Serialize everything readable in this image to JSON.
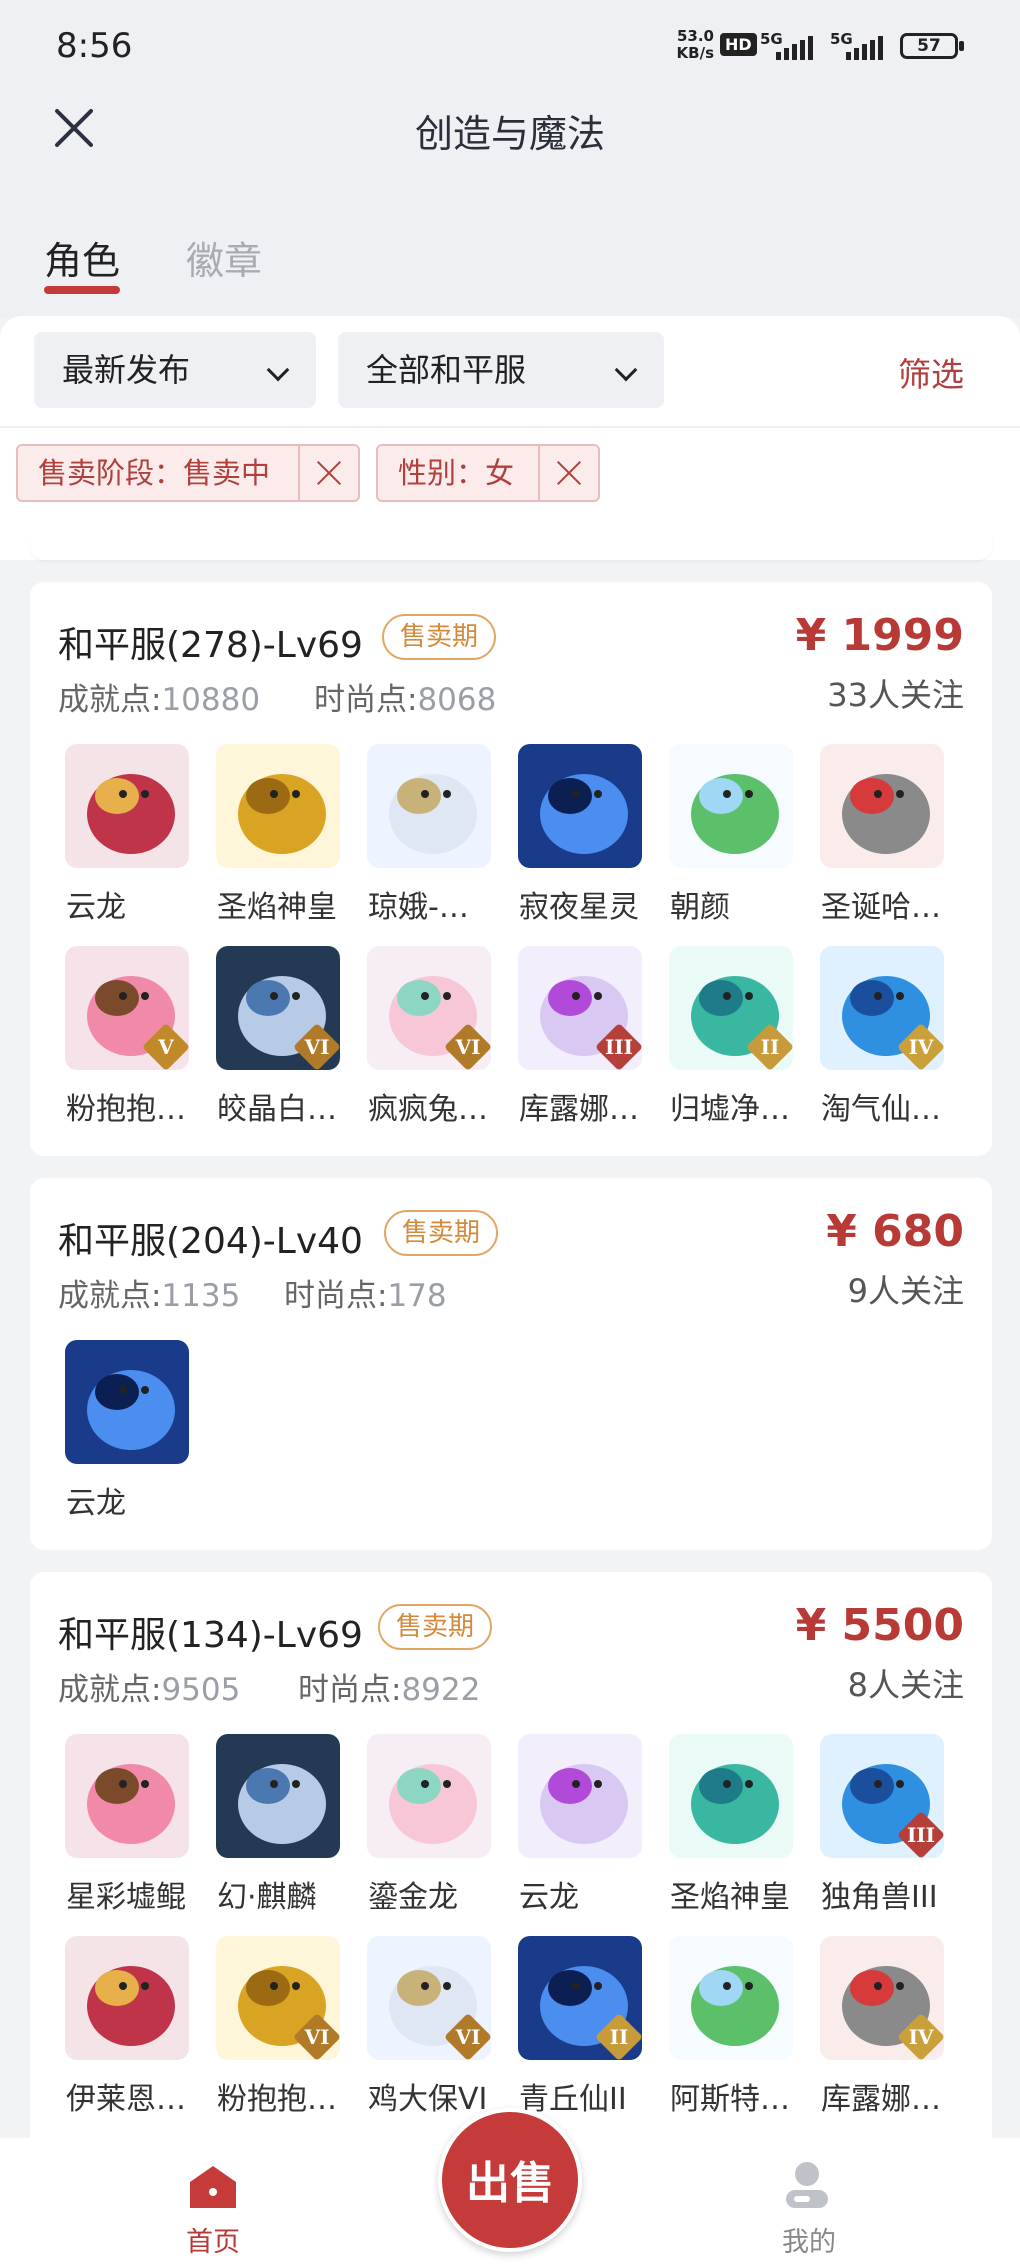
{
  "status_bar": {
    "time": "8:56",
    "net_speed_value": "53.0",
    "net_speed_unit": "KB/s",
    "hd": "HD",
    "sig1": "5G",
    "sig2": "5G",
    "battery": "57"
  },
  "header": {
    "title": "创造与魔法"
  },
  "tabs": {
    "active": "角色",
    "inactive": "徽章"
  },
  "filters": {
    "sort_label": "最新发布",
    "server_label": "全部和平服",
    "filter_link": "筛选",
    "chips": [
      "售卖阶段：售卖中",
      "性别：女"
    ]
  },
  "listings": [
    {
      "title": "和平服(278)-Lv69",
      "badge": "售卖期",
      "price": "¥ 1999",
      "follows": "33人关注",
      "achievement_label": "成就点:",
      "achievement_value": "10880",
      "fashion_label": "时尚点:",
      "fashion_value": "8068",
      "items": [
        "云龙",
        "圣焰神皇",
        "琼娥-…",
        "寂夜星灵",
        "朝颜",
        "圣诞哈…",
        "粉抱抱…",
        "皎晶白…",
        "疯疯兔…",
        "库露娜…",
        "归墟净…",
        "淘气仙…"
      ],
      "ranks": [
        "",
        "",
        "",
        "",
        "",
        "",
        "V",
        "VI",
        "VI",
        "III",
        "II",
        "IV"
      ]
    },
    {
      "title": "和平服(204)-Lv40",
      "badge": "售卖期",
      "price": "¥ 680",
      "follows": "9人关注",
      "achievement_label": "成就点:",
      "achievement_value": "1135",
      "fashion_label": "时尚点:",
      "fashion_value": "178",
      "items": [
        "云龙"
      ],
      "ranks": [
        ""
      ]
    },
    {
      "title": "和平服(134)-Lv69",
      "badge": "售卖期",
      "price": "¥ 5500",
      "follows": "8人关注",
      "achievement_label": "成就点:",
      "achievement_value": "9505",
      "fashion_label": "时尚点:",
      "fashion_value": "8922",
      "items": [
        "星彩墟鲲",
        "幻·麒麟",
        "鎏金龙",
        "云龙",
        "圣焰神皇",
        "独角兽III",
        "伊莱恩…",
        "粉抱抱…",
        "鸡大保VI",
        "青丘仙II",
        "阿斯特…",
        "库露娜…"
      ],
      "ranks": [
        "",
        "",
        "",
        "",
        "",
        "III",
        "",
        "VI",
        "VI",
        "II",
        "",
        "IV"
      ]
    }
  ],
  "tabbar": {
    "home": "首页",
    "sell": "出售",
    "me": "我的"
  },
  "colors": {
    "accent": "#c43b39",
    "badge": "#d58a3a",
    "background": "#f2f3f5"
  }
}
